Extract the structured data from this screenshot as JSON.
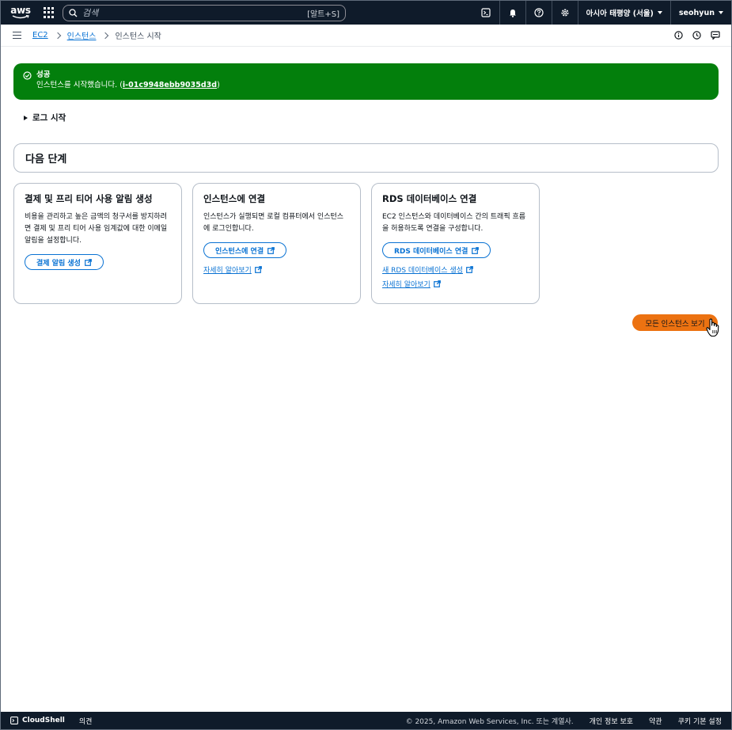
{
  "topnav": {
    "logo_text": "aws",
    "search_placeholder": "검색",
    "search_shortcut": "[알트+S]",
    "region": "아시아 태평양 (서울)",
    "user": "seohyun",
    "icons": [
      "cloudshell-icon",
      "bell-icon",
      "help-icon",
      "settings-icon"
    ]
  },
  "breadcrumb": {
    "items": [
      "EC2",
      "인스턴스"
    ],
    "current": "인스턴스 시작"
  },
  "flash": {
    "title": "성공",
    "message_prefix": "인스턴스를 시작했습니다. (",
    "instance_id": "i-01c9948ebb9035d3d",
    "message_suffix": ")"
  },
  "log_expander": "로그 시작",
  "next_steps_title": "다음 단계",
  "cards": [
    {
      "title": "결제 및 프리 티어 사용 알림 생성",
      "body": "비용을 관리하고 높은 금액의 청구서를 방지하려면 결제 및 프리 티어 사용 임계값에 대한 이메일 알림을 설정합니다.",
      "button": "결제 알림 생성"
    },
    {
      "title": "인스턴스에 연결",
      "body": "인스턴스가 실행되면 로컬 컴퓨터에서 인스턴스에 로그인합니다.",
      "button": "인스턴스에 연결",
      "links": [
        "자세히 알아보기"
      ]
    },
    {
      "title": "RDS 데이터베이스 연결",
      "body": "EC2 인스턴스와 데이터베이스 간의 트래픽 흐름을 허용하도록 연결을 구성합니다.",
      "button": "RDS 데이터베이스 연결",
      "links": [
        "새 RDS 데이터베이스 생성",
        "자세히 알아보기"
      ]
    }
  ],
  "primary_button": "모든 인스턴스 보기",
  "footer": {
    "cloudshell": "CloudShell",
    "feedback": "의견",
    "copyright": "© 2025, Amazon Web Services, Inc. 또는 계열사.",
    "links": [
      "개인 정보 보호",
      "약관",
      "쿠키 기본 설정"
    ]
  },
  "colors": {
    "nav_bg": "#0f1b2a",
    "success": "#037f0c",
    "link": "#0972d3",
    "primary": "#ec7211"
  }
}
